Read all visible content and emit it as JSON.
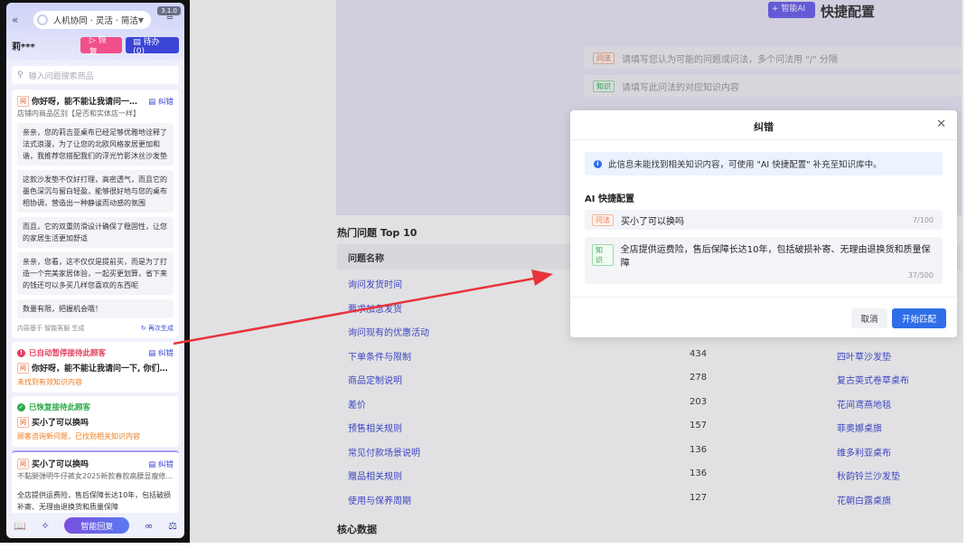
{
  "side": {
    "mode_label": "人机协同 · 灵活 · 简洁",
    "version": "3.1.0",
    "user": "莉***",
    "restore_label": "▷ 恢复",
    "todo_label": "▤ 待办 (0)",
    "search_placeholder": "输入问题搜索商品",
    "fix_label": "纠错",
    "q_tag": "问",
    "card1": {
      "title": "你好呀，能不能让我请问一下, ...",
      "sub": "店铺内商品区别【是否和实体店一样】",
      "replies": [
        "亲亲，您的莉吉亚桌布已经足够优雅地诠释了法式浪漫，为了让您的北欧风格家居更加和谐，我推荐您搭配我们的浮光竹影沐丝沙发垫",
        "这款沙发垫不仅好打理，高密透气，而且它的墨色深沉与留白轻盈，能够很好地与您的桌布相协调，营造出一种静谧而动感的氛围",
        "而且，它的双重防滑设计确保了稳固性，让您的家居生活更加舒适",
        "亲亲，您看，这不仅仅是提前买，而是为了打造一个完美家居体验，一起买更划算，省下来的钱还可以多买几样您喜欢的东西呢",
        "数量有限，把握机会哦！"
      ],
      "footer": "内容基于 智能客服 生成",
      "regen": "再次生成"
    },
    "card2": {
      "status": "已自动暂停接待此顾客",
      "title": "你好呀，能不能让我请问一下, 你们是不...",
      "note": "未找到有效知识内容"
    },
    "card3": {
      "status": "已恢复接待此顾客",
      "title": "买小了可以换吗",
      "note": "顾客咨询新问题，已找到相关知识内容"
    },
    "card4": {
      "title": "买小了可以换吗",
      "sub": "不黏腿弹明牛仔裤女2025新款春款高腰显瘦修...",
      "reply": "全店提供运费险，售后保障长达10年，包括破损补寄、无理由退换货和质量保障"
    },
    "smart_reply": "智能回复"
  },
  "bg": {
    "ai_btn": "+ 智能AI",
    "section_title": "快捷配置",
    "q_tag": "问法",
    "k_tag": "知识",
    "q_placeholder": "请填写您认为可能的问题或问法，多个问法用 \"/\" 分隔",
    "k_placeholder": "请填写此问法的对应知识内容",
    "hot_title": "热门问题 Top 10",
    "col_question": "问题名称",
    "rows": [
      {
        "q": "询问发货时间",
        "count": "",
        "product": ""
      },
      {
        "q": "要求加急发货",
        "count": "",
        "product": ""
      },
      {
        "q": "询问现有的优惠活动",
        "count": "",
        "product": ""
      },
      {
        "q": "下单条件与限制",
        "count": "434",
        "product": "四叶草沙发垫"
      },
      {
        "q": "商品定制说明",
        "count": "278",
        "product": "复古英式卷草桌布"
      },
      {
        "q": "差价",
        "count": "203",
        "product": "花间鸢燕地毯"
      },
      {
        "q": "预售相关规则",
        "count": "157",
        "product": "菲奥娜桌旗"
      },
      {
        "q": "常见付款场景说明",
        "count": "136",
        "product": "维多利亚桌布"
      },
      {
        "q": "赠品相关规则",
        "count": "136",
        "product": "秋韵铃兰沙发垫"
      },
      {
        "q": "使用与保养周期",
        "count": "127",
        "product": "花朝白露桌旗"
      }
    ],
    "core_title": "核心数据"
  },
  "modal": {
    "title": "纠错",
    "info": "此信息未能找到相关知识内容，可使用 \"AI 快捷配置\" 补充至知识库中。",
    "cfg_label": "AI 快捷配置",
    "q_tag": "问法",
    "q_value": "买小了可以换吗",
    "q_count": "7/100",
    "k_tag": "知识",
    "k_value": "全店提供运费险，售后保障长达10年，包括破损补寄、无理由退换货和质量保障",
    "k_count": "37/500",
    "cancel": "取消",
    "start": "开始匹配"
  },
  "colors": {
    "accent": "#2f6ee8",
    "arrow": "#e8333a",
    "danger": "#e83d5c",
    "success": "#2ba84a"
  }
}
